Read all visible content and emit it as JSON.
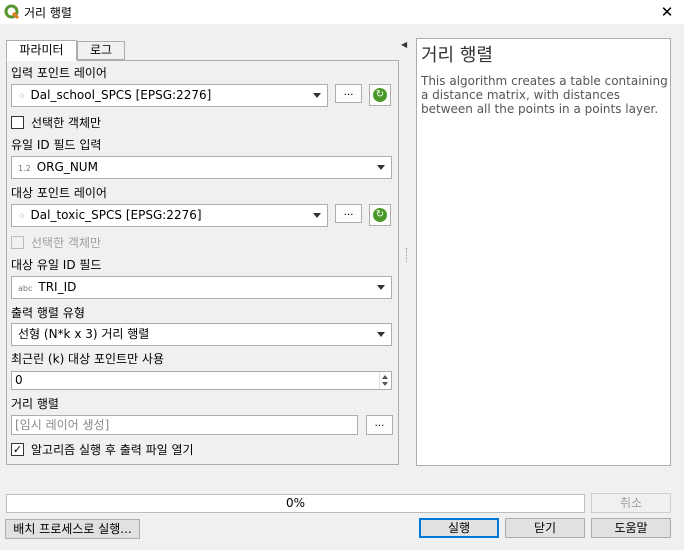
{
  "window": {
    "title": "거리 행렬",
    "logo_icon": "qgis-logo-icon",
    "close_glyph": "✕"
  },
  "tabs": [
    {
      "label": "파라미터",
      "active": true
    },
    {
      "label": "로그",
      "active": false
    }
  ],
  "form": {
    "input_layer_label": "입력 포인트 레이어",
    "input_layer_value": "Dal_school_SPCS [EPSG:2276]",
    "selected_only_1_label": "선택한 객체만",
    "input_id_label": "유일 ID 필드 입력",
    "input_id_type": "1.2",
    "input_id_value": "ORG_NUM",
    "target_layer_label": "대상 포인트 레이어",
    "target_layer_value": "Dal_toxic_SPCS [EPSG:2276]",
    "selected_only_2_label": "선택한 객체만",
    "target_id_label": "대상 유일 ID 필드",
    "target_id_type": "abc",
    "target_id_value": "TRI_ID",
    "matrix_type_label": "출력 행렬 유형",
    "matrix_type_value": "선형 (N*k x 3) 거리 행렬",
    "k_nearest_label": "최근린 (k) 대상 포인트만 사용",
    "k_nearest_value": "0",
    "output_label": "거리 행렬",
    "output_placeholder": "[임시 레이어 생성]",
    "open_output_label": "알고리즘 실행 후 출력 파일 열기",
    "dots": "…"
  },
  "help": {
    "title": "거리 행렬",
    "description": "This algorithm creates a table containing a distance matrix, with distances between all the points in a points layer."
  },
  "progress": {
    "percent": 0,
    "text": "0%"
  },
  "buttons": {
    "cancel": "취소",
    "batch": "배치 프로세스로 실행...",
    "run": "실행",
    "close": "닫기",
    "help": "도움말"
  },
  "colors": {
    "accent": "#0078d7",
    "run_icon": "#4c9a2a",
    "progress": "#06b025"
  }
}
